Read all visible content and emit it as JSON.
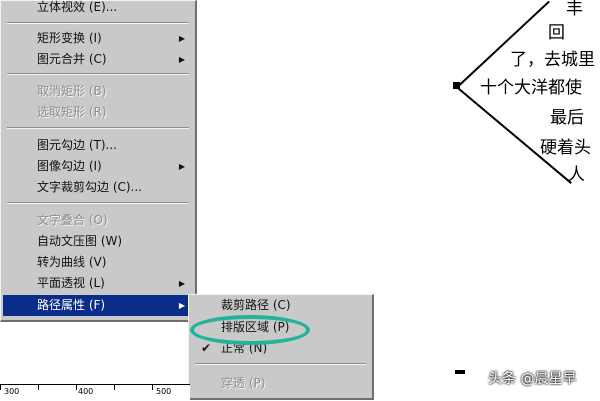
{
  "main_menu": {
    "items": [
      {
        "label": "立体视效 (E)...",
        "disabled": false
      },
      {
        "label": "矩形变换 (I)",
        "disabled": false,
        "submenu": true
      },
      {
        "label": "图元合并 (C)",
        "disabled": false,
        "submenu": true
      },
      {
        "label": "取消矩形 (B)",
        "disabled": true
      },
      {
        "label": "选取矩形 (R)",
        "disabled": true
      },
      {
        "label": "图元勾边 (T)...",
        "disabled": false
      },
      {
        "label": "图像勾边 (I)",
        "disabled": false,
        "submenu": true
      },
      {
        "label": "文字裁剪勾边 (C)...",
        "disabled": false
      },
      {
        "label": "文字叠合 (O)",
        "disabled": true
      },
      {
        "label": "自动文压图 (W)",
        "disabled": false
      },
      {
        "label": "转为曲线 (V)",
        "disabled": false
      },
      {
        "label": "平面透视 (L)",
        "disabled": false,
        "submenu": true
      },
      {
        "label": "路径属性 (F)",
        "disabled": false,
        "submenu": true,
        "selected": true
      }
    ]
  },
  "sub_menu": {
    "items": [
      {
        "label": "裁剪路径 (C)",
        "checked": false,
        "disabled": false
      },
      {
        "label": "排版区域 (P)",
        "checked": false,
        "disabled": false,
        "highlighted": true
      },
      {
        "label": "正常 (N)",
        "checked": true,
        "disabled": false
      },
      {
        "label": "穿透 (P)",
        "checked": false,
        "disabled": true
      }
    ]
  },
  "ruler": {
    "labels": [
      "300",
      "400",
      "500"
    ]
  },
  "poem": {
    "lines": [
      "丰",
      "回",
      "了，去城里",
      "十个大洋都使",
      "最后",
      "硬着头",
      "人"
    ]
  },
  "watermark": "头条 @晨星早",
  "colors": {
    "menu_bg": "#c9c9c9",
    "selected_bg": "#0b2d8a",
    "highlight_ring": "#22b39a"
  }
}
